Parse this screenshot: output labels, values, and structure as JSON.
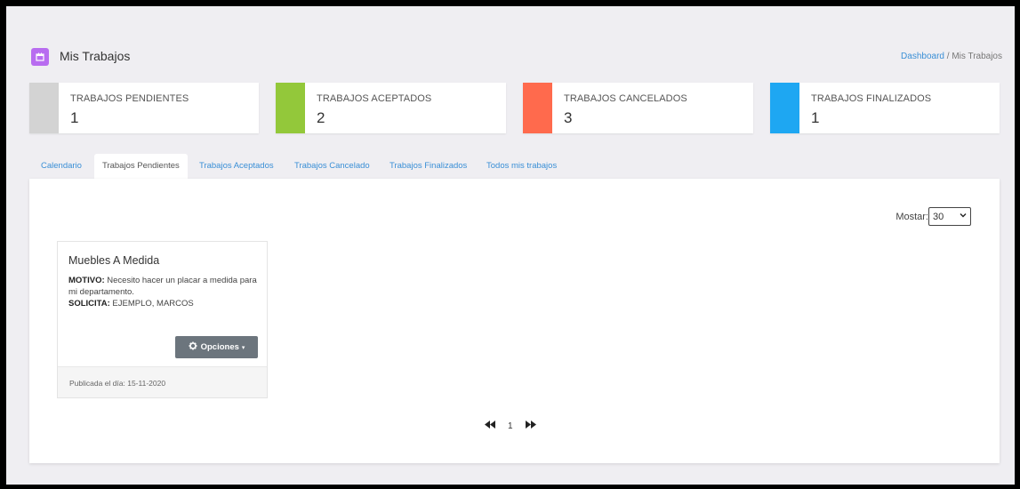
{
  "header": {
    "title": "Mis Trabajos",
    "breadcrumb_link": "Dashboard",
    "breadcrumb_sep": " / ",
    "breadcrumb_current": "Mis Trabajos"
  },
  "stats": [
    {
      "label": "TRABAJOS PENDIENTES",
      "value": "1",
      "color": "#d3d3d3"
    },
    {
      "label": "TRABAJOS ACEPTADOS",
      "value": "2",
      "color": "#93c83a"
    },
    {
      "label": "TRABAJOS CANCELADOS",
      "value": "3",
      "color": "#ff6a4d"
    },
    {
      "label": "TRABAJOS FINALIZADOS",
      "value": "1",
      "color": "#1ea7f2"
    }
  ],
  "tabs": [
    {
      "label": "Calendario"
    },
    {
      "label": "Trabajos Pendientes"
    },
    {
      "label": "Trabajos Aceptados"
    },
    {
      "label": "Trabajos Cancelado"
    },
    {
      "label": "Trabajos Finalizados"
    },
    {
      "label": "Todos mis trabajos"
    }
  ],
  "active_tab": "Trabajos Pendientes",
  "mostrar": {
    "label": "Mostar:",
    "selected": "30"
  },
  "card": {
    "title": "Muebles A Medida",
    "motivo_label": "MOTIVO:",
    "motivo_text": " Necesito hacer un placar a medida para mi departamento.",
    "solicita_label": "SOLICITA:",
    "solicita_text": " EJEMPLO, MARCOS",
    "options_label": "Opciones",
    "footer": "Publicada el día: 15-11-2020"
  },
  "pager": {
    "first_icon": "fast-backward-icon",
    "page": "1",
    "last_icon": "fast-forward-icon"
  }
}
